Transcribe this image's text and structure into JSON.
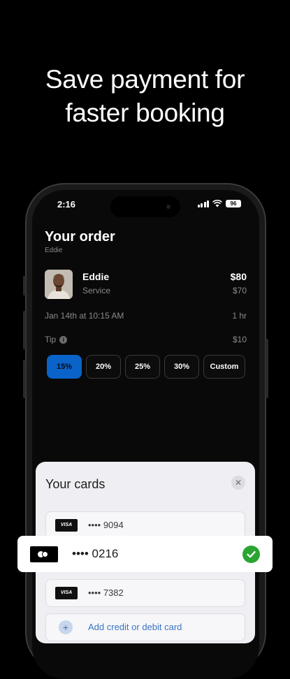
{
  "headline": {
    "line1": "Save payment for",
    "line2": "faster booking"
  },
  "status_bar": {
    "time": "2:16",
    "battery": "96"
  },
  "order": {
    "title": "Your order",
    "subtitle": "Eddie",
    "provider_name": "Eddie",
    "service_label": "Service",
    "total": "$80",
    "service_price": "$70",
    "date": "Jan 14th at 10:15 AM",
    "duration": "1 hr",
    "tip_label": "Tip",
    "tip_amount": "$10",
    "tip_options": [
      "15%",
      "20%",
      "25%",
      "30%",
      "Custom"
    ],
    "selected_tip": "15%"
  },
  "cards_sheet": {
    "title": "Your cards",
    "cards": [
      {
        "brand": "VISA",
        "number": "•••• 9094"
      },
      {
        "brand": "VISA",
        "number": "•••• 7382"
      }
    ],
    "add_card": "Add credit or debit card"
  },
  "selected_card": {
    "brand": "mastercard",
    "number": "•••• 0216",
    "selected": true
  },
  "colors": {
    "accent": "#0A63C9",
    "check": "#2AA532",
    "background": "#000000"
  }
}
